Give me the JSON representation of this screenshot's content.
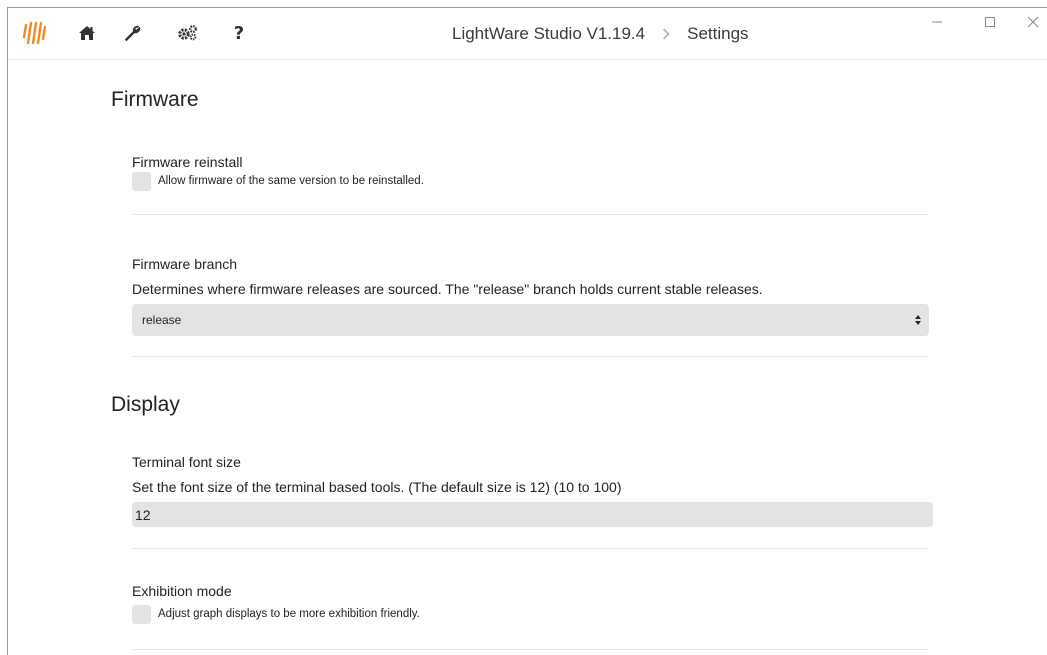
{
  "app": {
    "title": "LightWare Studio V1.19.4",
    "page": "Settings",
    "brand_color": "#f08a24"
  },
  "toolbar": {
    "icons": [
      "home-icon",
      "wrench-icon",
      "gears-icon",
      "help-icon"
    ],
    "help_label": "?"
  },
  "window_controls": [
    "minimize",
    "maximize",
    "close"
  ],
  "sections": {
    "firmware": {
      "title": "Firmware",
      "reinstall": {
        "title": "Firmware reinstall",
        "checkbox_label": "Allow firmware of the same version to be reinstalled.",
        "checked": false
      },
      "branch": {
        "title": "Firmware branch",
        "description": "Determines where firmware releases are sourced. The \"release\" branch holds current stable releases.",
        "selected": "release"
      }
    },
    "display": {
      "title": "Display",
      "terminal_font": {
        "title": "Terminal font size",
        "description": "Set the font size of the terminal based tools. (The default size is 12) (10 to 100)",
        "value": "12"
      },
      "exhibition": {
        "title": "Exhibition mode",
        "checkbox_label": "Adjust graph displays to be more exhibition friendly.",
        "checked": false
      }
    }
  }
}
